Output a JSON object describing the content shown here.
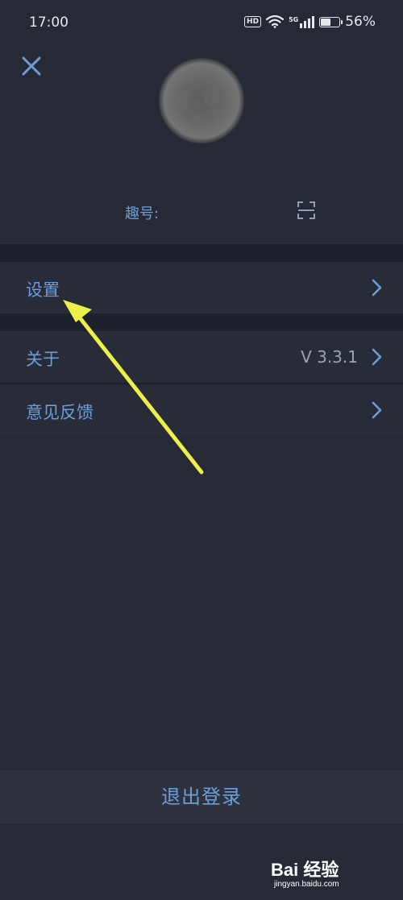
{
  "status_bar": {
    "time": "17:00",
    "hd": "HD",
    "network": "5G",
    "battery_percent": "56%",
    "battery_level": 0.56,
    "icons": [
      "hd-icon",
      "wifi-icon",
      "signal-5g-icon",
      "battery-icon"
    ]
  },
  "header": {
    "close_icon": "close-icon",
    "avatar_text": "ℳ.01",
    "qu_label": "趣号:",
    "scan_icon": "scan-icon"
  },
  "menu": {
    "settings": {
      "label": "设置",
      "icon": "chevron-right-icon"
    },
    "about": {
      "label": "关于",
      "value": "V 3.3.1",
      "icon": "chevron-right-icon"
    },
    "feedback": {
      "label": "意见反馈",
      "icon": "chevron-right-icon"
    }
  },
  "footer": {
    "logout_label": "退出登录"
  },
  "watermark": {
    "title": "Bai 经验",
    "url": "jingyan.baidu.com"
  },
  "colors": {
    "background": "#252a36",
    "row_background": "#272c38",
    "separator": "#1d212b",
    "accent_text": "#6e9ed8",
    "annotation_arrow": "#eef04a"
  }
}
